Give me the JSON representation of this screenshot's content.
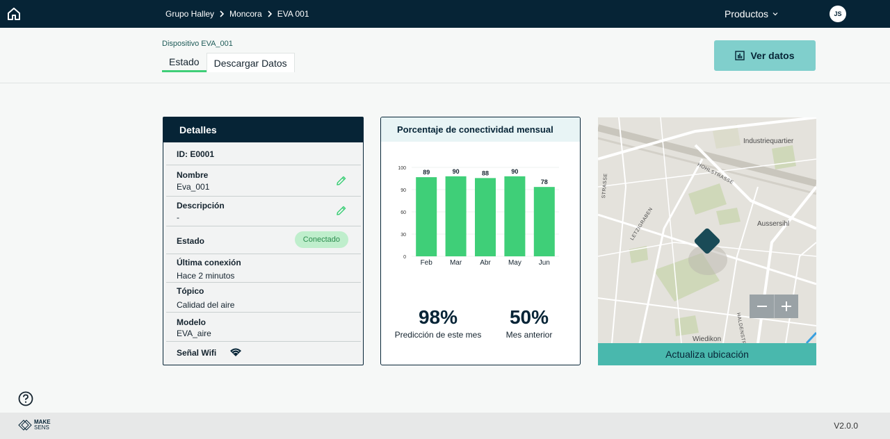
{
  "topbar": {
    "breadcrumb": [
      "Grupo Halley",
      "Moncora",
      "EVA 001"
    ],
    "products_label": "Productos",
    "avatar_initials": "JS"
  },
  "subheader": {
    "device_label": "Dispositivo EVA_001",
    "tabs": [
      {
        "label": "Estado",
        "active": true
      },
      {
        "label": "Descargar Datos",
        "active": false
      }
    ],
    "ver_datos_label": "Ver datos"
  },
  "details": {
    "title": "Detalles",
    "id_line": "ID: E0001",
    "nombre_label": "Nombre",
    "nombre_value": "Eva_001",
    "descripcion_label": "Descripción",
    "descripcion_value": "-",
    "estado_label": "Estado",
    "estado_value": "Conectado",
    "ultima_label": "Última conexión",
    "ultima_value": "Hace 2 minutos",
    "topico_label": "Tópico",
    "topico_value": "Calidad del aire",
    "modelo_label": "Modelo",
    "modelo_value": "EVA_aire",
    "wifi_label": "Señal Wifi"
  },
  "chart_data": {
    "type": "bar",
    "title": "Porcentaje de conectividad mensual",
    "categories": [
      "Feb",
      "Mar",
      "Abr",
      "May",
      "Jun"
    ],
    "values": [
      89,
      90,
      88,
      90,
      78
    ],
    "yticks": [
      100,
      90,
      60,
      30,
      0
    ],
    "ylim": [
      0,
      100
    ],
    "color": "#3fcf78",
    "grid": true
  },
  "stats": {
    "prediccion_value": "98%",
    "prediccion_label": "Predicción de este mes",
    "anterior_value": "50%",
    "anterior_label": "Mes anterior"
  },
  "map": {
    "labels": [
      "Industriequartier",
      "Aussersihl",
      "Wiedikon",
      "HOHLSTRASSE",
      "LETZIGRABEN",
      "STRASSE",
      "HALDENSTR"
    ],
    "update_label": "Actualiza ubicación"
  },
  "footer": {
    "logo_top": "MAKE",
    "logo_bottom": "SENS",
    "version": "V2.0.0"
  },
  "colors": {
    "navy": "#062436",
    "accent_green": "#3fcf78",
    "teal": "#49b8ad"
  }
}
